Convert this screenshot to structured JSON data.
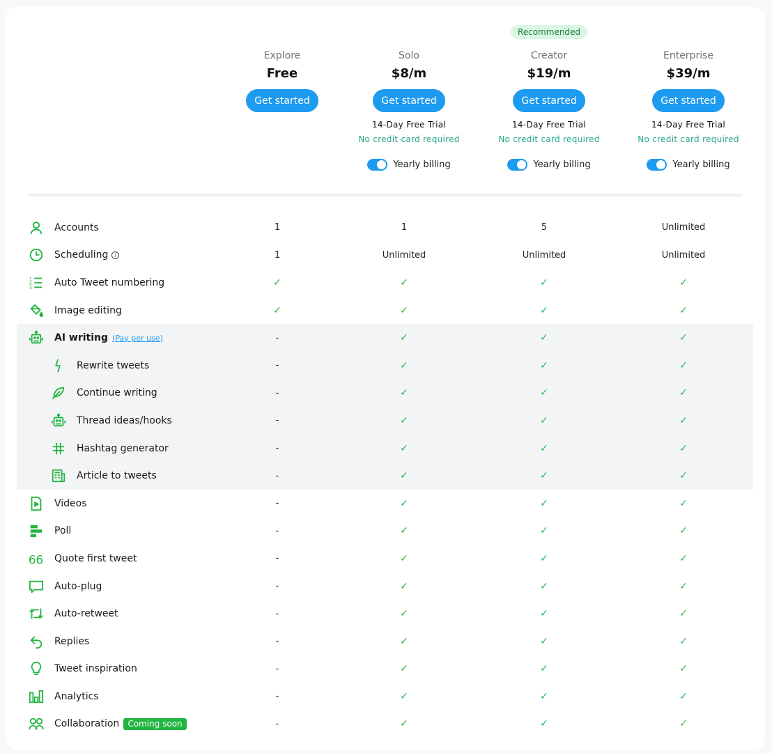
{
  "colors": {
    "primary": "#1d9bf0",
    "accent_green": "#22b541",
    "teal_text": "#27a88a",
    "recommended_bg": "#d9f7e3",
    "ai_section_bg": "#f3f4f6"
  },
  "plans": [
    {
      "name": "Explore",
      "price": "Free",
      "cta": "Get started",
      "badge": null,
      "trial": null,
      "no_cc": null,
      "billing_label": null,
      "yearly_billing": null
    },
    {
      "name": "Solo",
      "price": "$8/m",
      "cta": "Get started",
      "badge": null,
      "trial": "14-Day Free Trial",
      "no_cc": "No credit card required",
      "billing_label": "Yearly billing",
      "yearly_billing": true
    },
    {
      "name": "Creator",
      "price": "$19/m",
      "cta": "Get started",
      "badge": "Recommended",
      "trial": "14-Day Free Trial",
      "no_cc": "No credit card required",
      "billing_label": "Yearly billing",
      "yearly_billing": true
    },
    {
      "name": "Enterprise",
      "price": "$39/m",
      "cta": "Get started",
      "badge": null,
      "trial": "14-Day Free Trial",
      "no_cc": "No credit card required",
      "billing_label": "Yearly billing",
      "yearly_billing": true
    }
  ],
  "features": [
    {
      "name": "Accounts",
      "icon": "user-icon",
      "values": [
        "1",
        "1",
        "5",
        "Unlimited"
      ]
    },
    {
      "name": "Scheduling",
      "icon": "clock-icon",
      "info": "i",
      "values": [
        "1",
        "Unlimited",
        "Unlimited",
        "Unlimited"
      ]
    },
    {
      "name": "Auto Tweet numbering",
      "icon": "numbered-list-icon",
      "values": [
        "✓",
        "✓",
        "✓",
        "✓"
      ]
    },
    {
      "name": "Image editing",
      "icon": "paint-bucket-icon",
      "values": [
        "✓",
        "✓",
        "✓",
        "✓"
      ]
    },
    {
      "name": "AI writing",
      "icon": "robot-icon",
      "group": "ai",
      "bold": true,
      "link": "(Pay per use)",
      "values": [
        "-",
        "✓",
        "✓",
        "✓"
      ]
    },
    {
      "name": "Rewrite tweets",
      "icon": "lightning-icon",
      "group": "ai",
      "sub": true,
      "values": [
        "-",
        "✓",
        "✓",
        "✓"
      ]
    },
    {
      "name": "Continue writing",
      "icon": "feather-icon",
      "group": "ai",
      "sub": true,
      "values": [
        "-",
        "✓",
        "✓",
        "✓"
      ]
    },
    {
      "name": "Thread ideas/hooks",
      "icon": "robot-icon",
      "group": "ai",
      "sub": true,
      "values": [
        "-",
        "✓",
        "✓",
        "✓"
      ]
    },
    {
      "name": "Hashtag generator",
      "icon": "hashtag-icon",
      "group": "ai",
      "sub": true,
      "values": [
        "-",
        "✓",
        "✓",
        "✓"
      ]
    },
    {
      "name": "Article to tweets",
      "icon": "newspaper-icon",
      "group": "ai",
      "sub": true,
      "values": [
        "-",
        "✓",
        "✓",
        "✓"
      ]
    },
    {
      "name": "Videos",
      "icon": "video-file-icon",
      "values": [
        "-",
        "✓",
        "✓",
        "✓"
      ]
    },
    {
      "name": "Poll",
      "icon": "poll-icon",
      "values": [
        "-",
        "✓",
        "✓",
        "✓"
      ]
    },
    {
      "name": "Quote first tweet",
      "icon": "quote-icon",
      "values": [
        "-",
        "✓",
        "✓",
        "✓"
      ]
    },
    {
      "name": "Auto-plug",
      "icon": "speech-bubble-icon",
      "values": [
        "-",
        "✓",
        "✓",
        "✓"
      ]
    },
    {
      "name": "Auto-retweet",
      "icon": "retweet-icon",
      "values": [
        "-",
        "✓",
        "✓",
        "✓"
      ]
    },
    {
      "name": "Replies",
      "icon": "reply-arrow-icon",
      "values": [
        "-",
        "✓",
        "✓",
        "✓"
      ]
    },
    {
      "name": "Tweet inspiration",
      "icon": "lightbulb-icon",
      "values": [
        "-",
        "✓",
        "✓",
        "✓"
      ]
    },
    {
      "name": "Analytics",
      "icon": "bar-chart-icon",
      "values": [
        "-",
        "✓",
        "✓",
        "✓"
      ]
    },
    {
      "name": "Collaboration",
      "icon": "users-icon",
      "badge": "Coming soon",
      "values": [
        "-",
        "✓",
        "✓",
        "✓"
      ]
    }
  ]
}
